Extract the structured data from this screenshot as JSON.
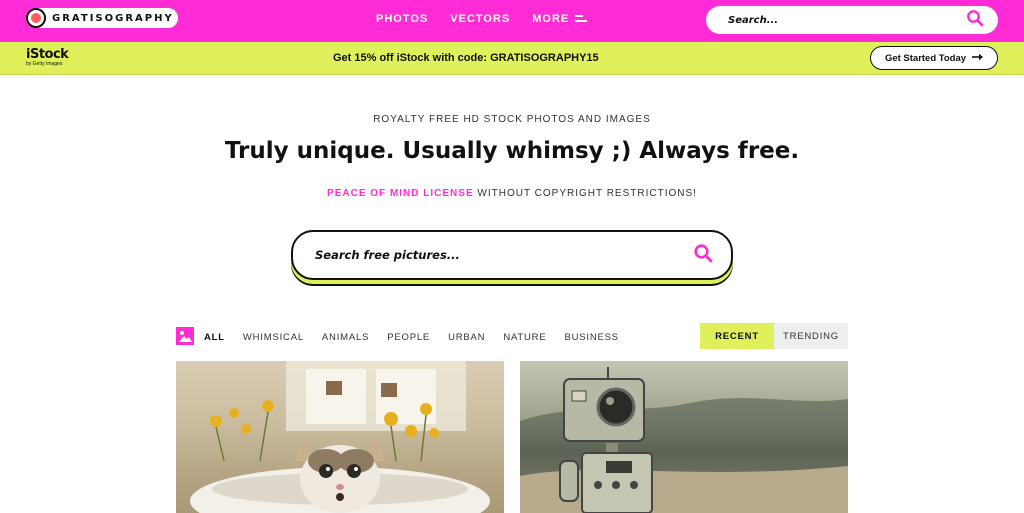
{
  "header": {
    "logo_text": "GRATISOGRAPHY",
    "nav": [
      {
        "label": "PHOTOS"
      },
      {
        "label": "VECTORS"
      },
      {
        "label": "MORE"
      }
    ],
    "search_placeholder": "Search..."
  },
  "promo": {
    "brand": "iStock",
    "brand_sub": "by Getty Images",
    "text": "Get 15% off iStock with code: GRATISOGRAPHY15",
    "cta_label": "Get Started Today"
  },
  "hero": {
    "eyebrow": "ROYALTY FREE HD STOCK PHOTOS AND IMAGES",
    "headline": "Truly unique. Usually whimsy ;) Always free.",
    "license_link": "PEACE OF MIND LICENSE",
    "license_rest": "WITHOUT COPYRIGHT RESTRICTIONS!",
    "search_placeholder": "Search free pictures..."
  },
  "filters": {
    "categories": [
      "ALL",
      "WHIMSICAL",
      "ANIMALS",
      "PEOPLE",
      "URBAN",
      "NATURE",
      "BUSINESS"
    ],
    "active": "ALL",
    "sort": [
      "RECENT",
      "TRENDING"
    ],
    "active_sort": "RECENT"
  },
  "colors": {
    "brand_pink": "#ff2bd6",
    "promo_lime": "#dff05a",
    "logo_dot": "#ff5a5f"
  },
  "icons": {
    "search": "search-icon",
    "menu": "menu-icon",
    "arrow": "arrow-right-icon",
    "filter": "image-filter-icon"
  }
}
